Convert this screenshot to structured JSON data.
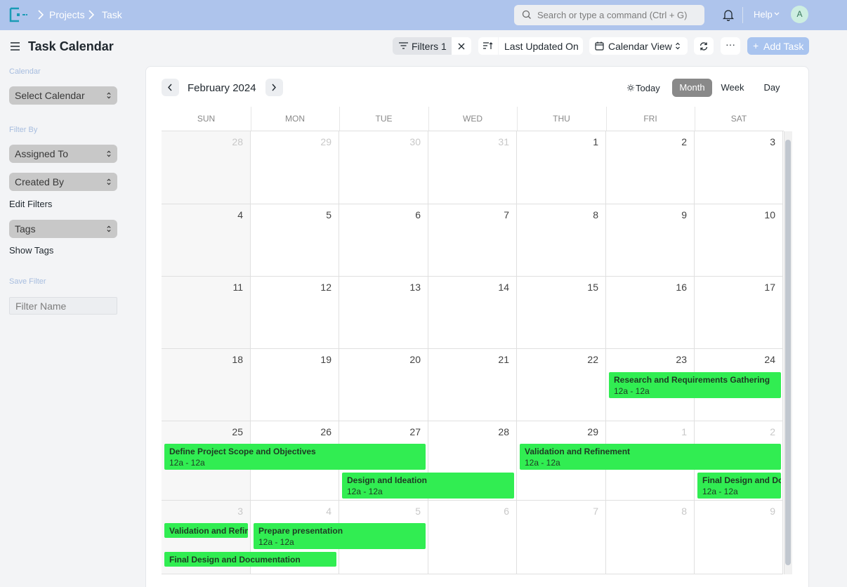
{
  "navbar": {
    "breadcrumbs": [
      "Projects",
      "Task"
    ],
    "search_placeholder": "Search or type a command (Ctrl + G)",
    "help_label": "Help",
    "avatar_initial": "A"
  },
  "page": {
    "title": "Task Calendar",
    "filters_label": "Filters 1",
    "sort_label": "Last Updated On",
    "view_label": "Calendar View",
    "more_label": "···",
    "add_label": "Add Task",
    "add_plus": "+"
  },
  "sidebar": {
    "calendar_label": "Calendar",
    "select_calendar": "Select Calendar",
    "filter_by_label": "Filter By",
    "assigned_to": "Assigned To",
    "created_by": "Created By",
    "edit_filters": "Edit Filters",
    "tags": "Tags",
    "show_tags": "Show Tags",
    "save_filter_label": "Save Filter",
    "filter_name_placeholder": "Filter Name"
  },
  "calendar": {
    "title": "February 2024",
    "today_label": "Today",
    "views": [
      "Month",
      "Week",
      "Day"
    ],
    "active_view": "Month",
    "weekdays": [
      "SUN",
      "MON",
      "TUE",
      "WED",
      "THU",
      "FRI",
      "SAT"
    ],
    "weeks": [
      [
        "28",
        "29",
        "30",
        "31",
        "1",
        "2",
        "3"
      ],
      [
        "4",
        "5",
        "6",
        "7",
        "8",
        "9",
        "10"
      ],
      [
        "11",
        "12",
        "13",
        "14",
        "15",
        "16",
        "17"
      ],
      [
        "18",
        "19",
        "20",
        "21",
        "22",
        "23",
        "24"
      ],
      [
        "25",
        "26",
        "27",
        "28",
        "29",
        "1",
        "2"
      ],
      [
        "3",
        "4",
        "5",
        "6",
        "7",
        "8",
        "9"
      ]
    ],
    "events": [
      {
        "title": "Research and Requirements Gathering",
        "time": "12a - 12a"
      },
      {
        "title": "Define Project Scope and Objectives",
        "time": "12a - 12a"
      },
      {
        "title": "Validation and Refinement",
        "time": "12a - 12a"
      },
      {
        "title": "Design and Ideation",
        "time": "12a - 12a"
      },
      {
        "title": "Final Design and Documentation",
        "time": "12a - 12a"
      },
      {
        "title": "Validation and Refinement",
        "time": ""
      },
      {
        "title": "Prepare presentation",
        "time": "12a - 12a"
      },
      {
        "title": "Final Design and Documentation",
        "time": ""
      }
    ]
  },
  "colors": {
    "navbar": "#aec4ec",
    "event": "#31ed52",
    "active_view": "#898989",
    "add_button": "#a9c4ef"
  }
}
